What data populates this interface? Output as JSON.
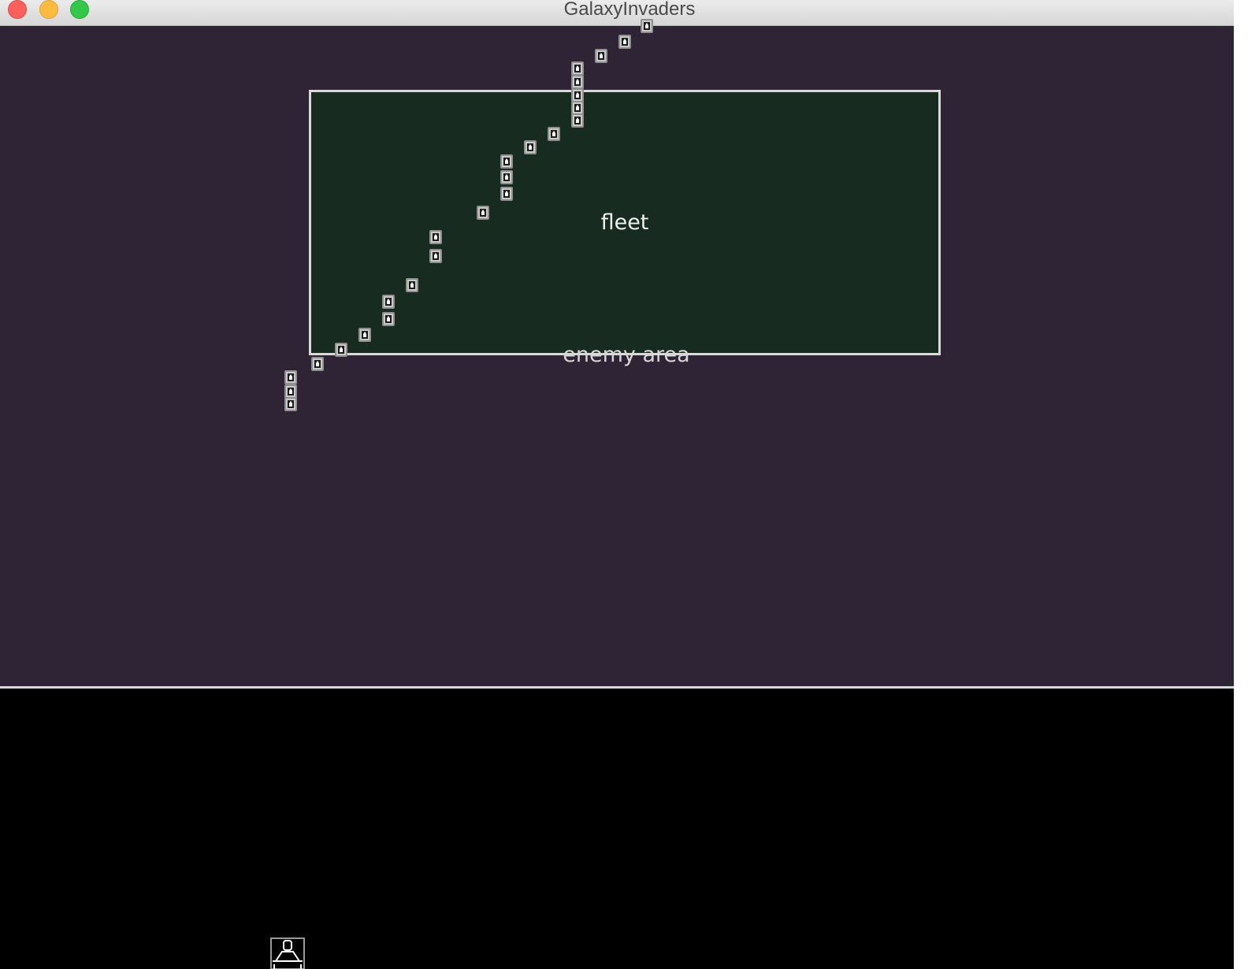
{
  "window": {
    "title": "GalaxyInvaders"
  },
  "playfield": {
    "enemy_area_label": "enemy area",
    "fleet_label": "fleet",
    "invader_icon": "invader-icon",
    "player_icon": "player-ship-icon"
  },
  "colors": {
    "playfield_bg": "#2f2336",
    "enemy_area_bg": "#182b21",
    "bottom_bg": "#000000",
    "outline": "#d9d9d9"
  }
}
